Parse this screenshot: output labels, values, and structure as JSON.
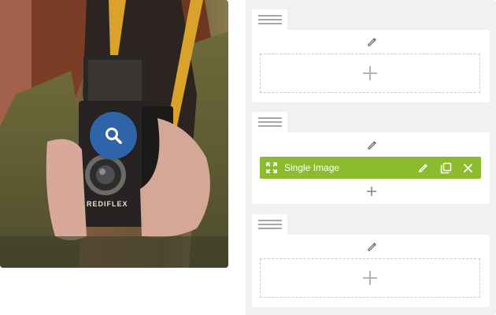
{
  "preview": {
    "camera_brand_text": "REDIFLEX",
    "zoom_icon": "magnifier-icon"
  },
  "builder": {
    "sections": [
      {
        "handle_icon": "drag-handle-icon",
        "edit_icon": "pencil-icon",
        "add_icon": "plus-icon"
      },
      {
        "handle_icon": "drag-handle-icon",
        "edit_icon": "pencil-icon",
        "element": {
          "label": "Single Image",
          "icons": [
            "expand-icon",
            "pencil-icon",
            "clone-icon",
            "close-icon"
          ]
        },
        "add_icon": "plus-icon"
      },
      {
        "handle_icon": "drag-handle-icon",
        "edit_icon": "pencil-icon",
        "add_icon": "plus-icon"
      }
    ]
  },
  "colors": {
    "zoom_button": "#2f65a8",
    "element_bar": "#8dbb2f",
    "panel_bg": "#f1f1f1"
  }
}
